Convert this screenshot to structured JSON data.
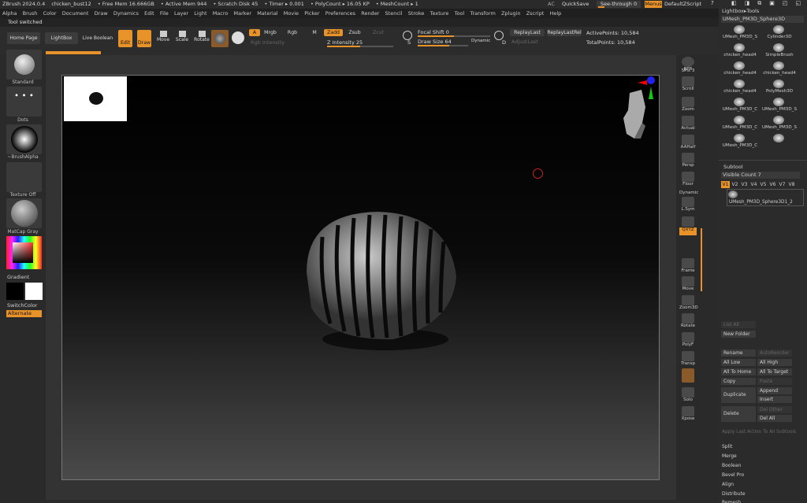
{
  "titlebar": {
    "app": "ZBrush 2024.0.4",
    "doc": "chicken_bust12",
    "free_mem": "• Free Mem 16.666GB",
    "active_mem": "• Active Mem 944",
    "scratch": "• Scratch Disk 45",
    "timer": "• Timer ▸ 0.001",
    "poly": "• PolyCount ▸ 16.05 KP",
    "mesh": "• MeshCount ▸ 1",
    "ac": "AC",
    "quicksave": "QuickSave",
    "seethrough": "See-through   0",
    "menus": "Menus",
    "script": "DefaultZScript"
  },
  "menu": [
    "Alpha",
    "Brush",
    "Color",
    "Document",
    "Draw",
    "Dynamics",
    "Edit",
    "File",
    "Layer",
    "Light",
    "Macro",
    "Marker",
    "Material",
    "Movie",
    "Picker",
    "Preferences",
    "Render",
    "Stencil",
    "Stroke",
    "Texture",
    "Tool",
    "Transform",
    "Zplugin",
    "Zscript",
    "Help"
  ],
  "status": "Tool switched",
  "toolbar": {
    "home": "Home Page",
    "lightbox": "LightBox",
    "live_boolean": "Live Boolean",
    "edit": "Edit",
    "draw": "Draw",
    "move": "Move",
    "scale": "Scale",
    "rotate": "Rotate",
    "a": "A",
    "mrgb": "Mrgb",
    "rgb": "Rgb",
    "m": "M",
    "rgb_intensity": "Rgb Intensity",
    "zadd": "Zadd",
    "zsub": "Zsub",
    "zcut": "Zcut",
    "z_intensity": "Z Intensity 25",
    "focal": "Focal Shift 0",
    "draw_size": "Draw Size 64",
    "dynamic": "Dynamic",
    "replay": "ReplayLast",
    "replay_rel": "ReplayLastRel",
    "adjust": "AdjustLast",
    "active_points": "ActivePoints: 10,584",
    "total_points": "TotalPoints: 10,584",
    "s_label": "S",
    "d_label": "D",
    "z_intensity_value": 0.5
  },
  "left": {
    "standard": "Standard",
    "dots": "Dots",
    "brush_alpha": "~BrushAlpha",
    "texture": "Texture Off",
    "matcap": "MatCap Gray",
    "gradient": "Gradient",
    "switchcolor": "SwitchColor",
    "alternate": "Alternate"
  },
  "right": {
    "bpr": "BPR",
    "spix": "SPix 3",
    "scroll": "Scroll",
    "zoom": "Zoom",
    "actual": "Actual",
    "aahalf": "AAHalf",
    "persp": "Persp",
    "floor": "Floor",
    "lsym": "L.Sym",
    "dynamic": "Dynamic",
    "xyz": "QXYZ",
    "frame": "Frame",
    "move": "Move",
    "zoom3d": "Zoom3D",
    "rotate": "Rotate",
    "polyf": "PolyF",
    "transp": "Transp",
    "solo": "Solo",
    "xpose": "Xpose"
  },
  "tray": {
    "lightbox_tools": "Lightbox▸Tools",
    "current_tool": "UMesh_PM3D_Sphere3D1",
    "tools": [
      "UMesh_PM3D_S",
      "Cylinder3D",
      "chicken_head4",
      "SimpleBrush",
      "chicken_head4",
      "chicken_head4",
      "chicken_head4",
      "PolyMesh3D",
      "UMesh_PM3D_C",
      "UMesh_PM3D_S",
      "UMesh_PM3D_C",
      "UMesh_PM3D_S",
      "UMesh_PM3D_C",
      ""
    ],
    "counts": [
      "3",
      "3",
      "3",
      "37"
    ],
    "subtool": "Subtool",
    "visible_count": "Visible Count 7",
    "versions": [
      "V1",
      "V2",
      "V3",
      "V4",
      "V5",
      "V6",
      "V7",
      "V8"
    ],
    "subtool_item": "UMesh_PM3D_Sphere3D1_2",
    "list_all": "List All",
    "new_folder": "New Folder",
    "rename": "Rename",
    "autoreorder": "AutoReorder",
    "all_low": "All Low",
    "all_high": "All High",
    "all_to_home": "All To Home",
    "all_to_target": "All To Target",
    "copy": "Copy",
    "paste": "Paste",
    "duplicate": "Duplicate",
    "append": "Append",
    "insert": "Insert",
    "delete": "Delete",
    "del_other": "Del Other",
    "del_all": "Del All",
    "apply_last": "Apply Last Action To All Subtools",
    "split": "Split",
    "merge": "Merge",
    "boolean": "Boolean",
    "bevel_pro": "Bevel Pro",
    "align": "Align",
    "distribute": "Distribute",
    "remesh": "Remesh"
  },
  "colors": {
    "accent": "#e8922a",
    "primary": "#000000",
    "secondary": "#ffffff"
  }
}
